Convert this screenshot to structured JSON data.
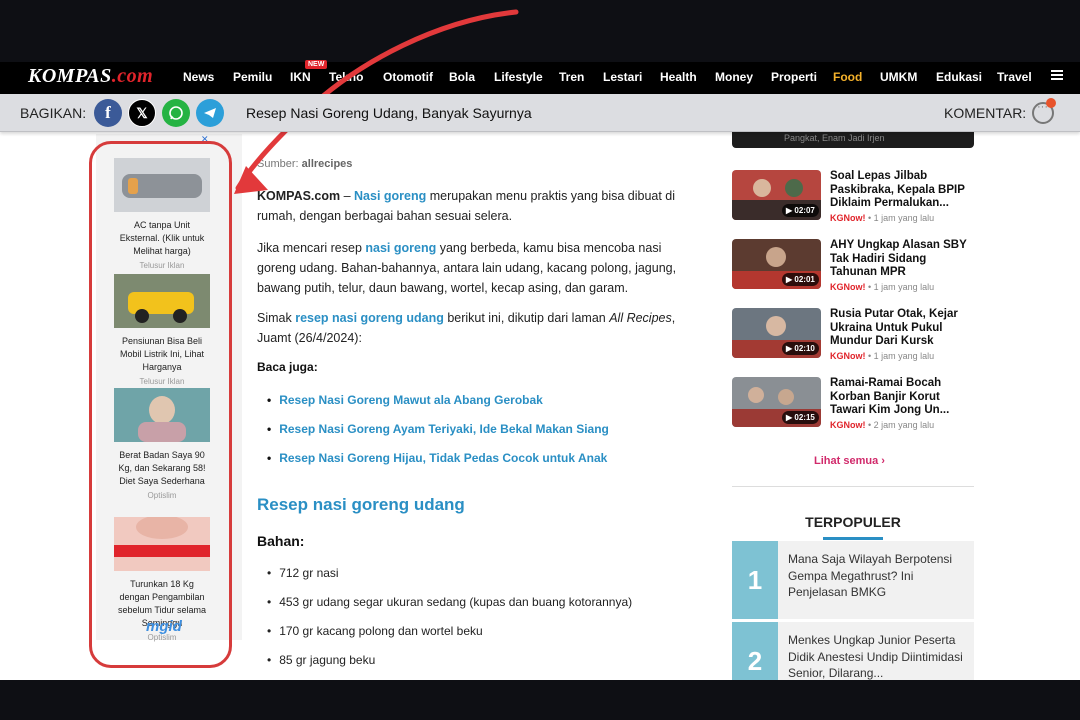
{
  "site": {
    "logo_main": "KOMPAS",
    "logo_suffix": ".com"
  },
  "nav": {
    "items": [
      "News",
      "Pemilu",
      "IKN",
      "Tekno",
      "Otomotif",
      "Bola",
      "Lifestyle",
      "Tren",
      "Lestari",
      "Health",
      "Money",
      "Properti",
      "Food",
      "UMKM",
      "Edukasi",
      "Travel"
    ],
    "new_badge": "NEW",
    "active": "Food"
  },
  "sharebar": {
    "label": "BAGIKAN:",
    "title": "Resep Nasi Goreng Udang, Banyak Sayurnya",
    "comment_label": "KOMENTAR:"
  },
  "ads": [
    {
      "title": "AC tanpa Unit Eksternal. (Klik untuk Melihat harga)",
      "source": "Telusur Iklan"
    },
    {
      "title": "Pensiunan Bisa Beli Mobil Listrik Ini, Lihat Harganya",
      "source": "Telusur Iklan"
    },
    {
      "title": "Berat Badan Saya 90 Kg, dan Sekarang 58! Diet Saya Sederhana",
      "source": "Optislim"
    },
    {
      "title": "Turunkan 18 Kg dengan Pengambilan sebelum Tidur selama Seminggu",
      "source": "Optislim"
    }
  ],
  "ad_network": "mgid",
  "article": {
    "source_label": "Sumber:",
    "source_name": "allrecipes",
    "p1_brand": "KOMPAS.com",
    "p1_dash": " – ",
    "p1_link": "Nasi goreng",
    "p1_rest": " merupakan menu praktis yang bisa dibuat di rumah, dengan berbagai bahan sesuai selera.",
    "p2_pre": "Jika mencari resep ",
    "p2_link": "nasi goreng",
    "p2_rest": " yang berbeda, kamu bisa mencoba nasi goreng udang. Bahan-bahannya, antara lain udang, kacang polong, jagung, bawang putih, telur, daun bawang, wortel, kecap asing, dan garam.",
    "p3_pre": "Simak ",
    "p3_link": "resep nasi goreng udang",
    "p3_mid": " berikut ini, dikutip dari laman ",
    "p3_italic": "All Recipes",
    "p3_rest": ", Juamt (26/4/2024):",
    "baca_juga": "Baca juga:",
    "related": [
      "Resep Nasi Goreng Mawut ala Abang Gerobak",
      "Resep Nasi Goreng Ayam Teriyaki, Ide Bekal Makan Siang",
      "Resep Nasi Goreng Hijau, Tidak Pedas Cocok untuk Anak"
    ],
    "heading": "Resep nasi goreng udang",
    "bahan": "Bahan:",
    "ingredients": [
      "712 gr nasi",
      "453 gr udang segar ukuran sedang (kupas dan buang kotorannya)",
      "170 gr kacang polong dan wortel beku",
      "85 gr jagung beku"
    ]
  },
  "sidebar": {
    "top_caption": "Pangkat, Enam Jadi Irjen",
    "videos": [
      {
        "title": "Soal Lepas Jilbab Paskibraka, Kepala BPIP Diklaim Permalukan...",
        "duration": "02:07",
        "source": "KGNow!",
        "time": "1 jam yang lalu"
      },
      {
        "title": "AHY Ungkap Alasan SBY Tak Hadiri Sidang Tahunan MPR",
        "duration": "02:01",
        "source": "KGNow!",
        "time": "1 jam yang lalu"
      },
      {
        "title": "Rusia Putar Otak, Kejar Ukraina Untuk Pukul Mundur Dari Kursk",
        "duration": "02:10",
        "source": "KGNow!",
        "time": "1 jam yang lalu"
      },
      {
        "title": "Ramai-Ramai Bocah Korban Banjir Korut Tawari Kim Jong Un...",
        "duration": "02:15",
        "source": "KGNow!",
        "time": "2 jam yang lalu"
      }
    ],
    "see_all": "Lihat semua",
    "terpopuler": "TERPOPULER",
    "popular": [
      {
        "rank": "1",
        "title": "Mana Saja Wilayah Berpotensi Gempa Megathrust? Ini Penjelasan BMKG"
      },
      {
        "rank": "2",
        "title": "Menkes Ungkap Junior Peserta Didik Anestesi Undip Diintimidasi Senior, Dilarang..."
      }
    ]
  },
  "colors": {
    "link": "#2a8fc4",
    "highlight": "#d63b3b",
    "active_nav": "#f5b22b",
    "brand_red": "#e0242b"
  }
}
